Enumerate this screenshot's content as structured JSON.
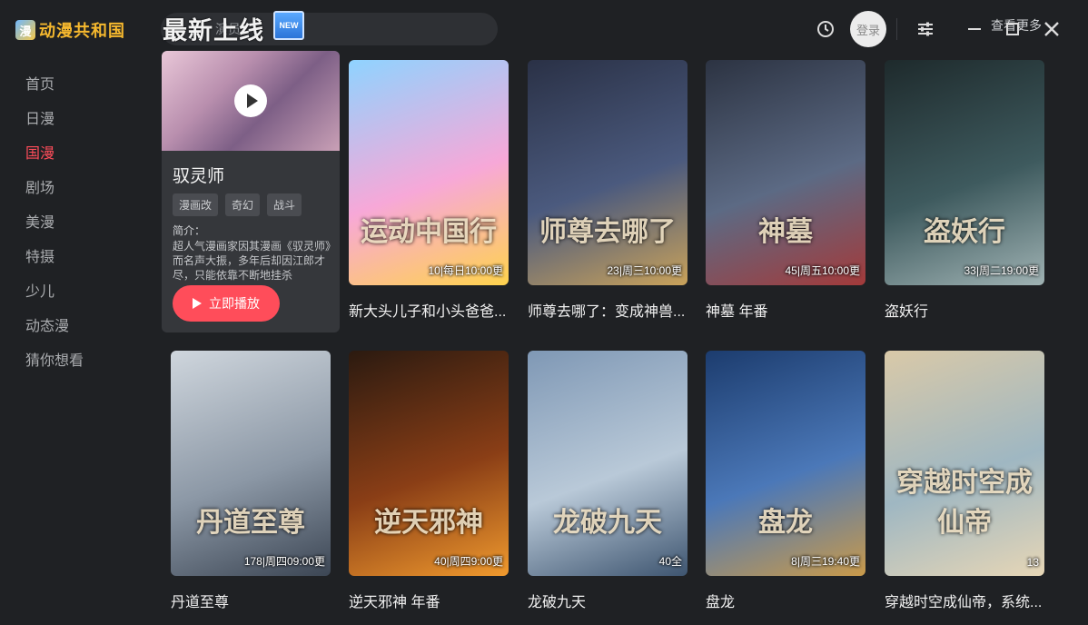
{
  "app": {
    "logo_text": "动漫共和国"
  },
  "nav": [
    {
      "label": "首页",
      "active": false
    },
    {
      "label": "日漫",
      "active": false
    },
    {
      "label": "国漫",
      "active": true
    },
    {
      "label": "剧场",
      "active": false
    },
    {
      "label": "美漫",
      "active": false
    },
    {
      "label": "特摄",
      "active": false
    },
    {
      "label": "少儿",
      "active": false
    },
    {
      "label": "动态漫",
      "active": false
    },
    {
      "label": "猜你想看",
      "active": false
    }
  ],
  "header": {
    "search_placeholder": "演员",
    "section_title": "最新上线",
    "new_badge": "NEW",
    "login_label": "登录",
    "more_label": "查看更多"
  },
  "featured": {
    "title": "驭灵师",
    "tags": [
      "漫画改",
      "奇幻",
      "战斗"
    ],
    "intro_label": "简介：",
    "intro_text": "超人气漫画家因其漫画《驭灵师》而名声大振，多年后却因江郎才尽，只能依靠不断地挂杀",
    "play_label": "立即播放"
  },
  "cards": [
    {
      "title": "新大头儿子和小头爸爸...",
      "badge": "10|每日10:00更",
      "art": "运动中国行",
      "colors": [
        "#8fd3ff",
        "#f7a8d8",
        "#ffd34d"
      ]
    },
    {
      "title": "师尊去哪了：变成神兽...",
      "badge": "23|周三10:00更",
      "art": "师尊去哪了",
      "colors": [
        "#2a3146",
        "#4b5a7e",
        "#c9a25a"
      ]
    },
    {
      "title": "神墓 年番",
      "badge": "45|周五10:00更",
      "art": "神墓",
      "colors": [
        "#2c3342",
        "#5c6a84",
        "#a33a3a"
      ]
    },
    {
      "title": "盗妖行",
      "badge": "33|周二19:00更",
      "art": "盗妖行",
      "colors": [
        "#1e2a2c",
        "#3e5a5e",
        "#9fb2b3"
      ]
    },
    {
      "title": "丹道至尊",
      "badge": "178|周四09:00更",
      "art": "丹道至尊",
      "colors": [
        "#cfd6dd",
        "#8c98a6",
        "#3c4654"
      ]
    },
    {
      "title": "逆天邪神 年番",
      "badge": "40|周四9:00更",
      "art": "逆天邪神",
      "colors": [
        "#2b1a10",
        "#8a3e16",
        "#f09a2e"
      ]
    },
    {
      "title": "龙破九天",
      "badge": "40全",
      "art": "龙破九天",
      "colors": [
        "#7f98b5",
        "#b9c9d8",
        "#3e5570"
      ]
    },
    {
      "title": "盘龙",
      "badge": "8|周三19:40更",
      "art": "盘龙",
      "colors": [
        "#1c3c6e",
        "#4b78b8",
        "#c99a4a"
      ]
    },
    {
      "title": "穿越时空成仙帝，系统...",
      "badge": "13",
      "art": "穿越时空成仙帝",
      "colors": [
        "#d9c9a8",
        "#9fb7c2",
        "#e6d6b6"
      ]
    }
  ]
}
